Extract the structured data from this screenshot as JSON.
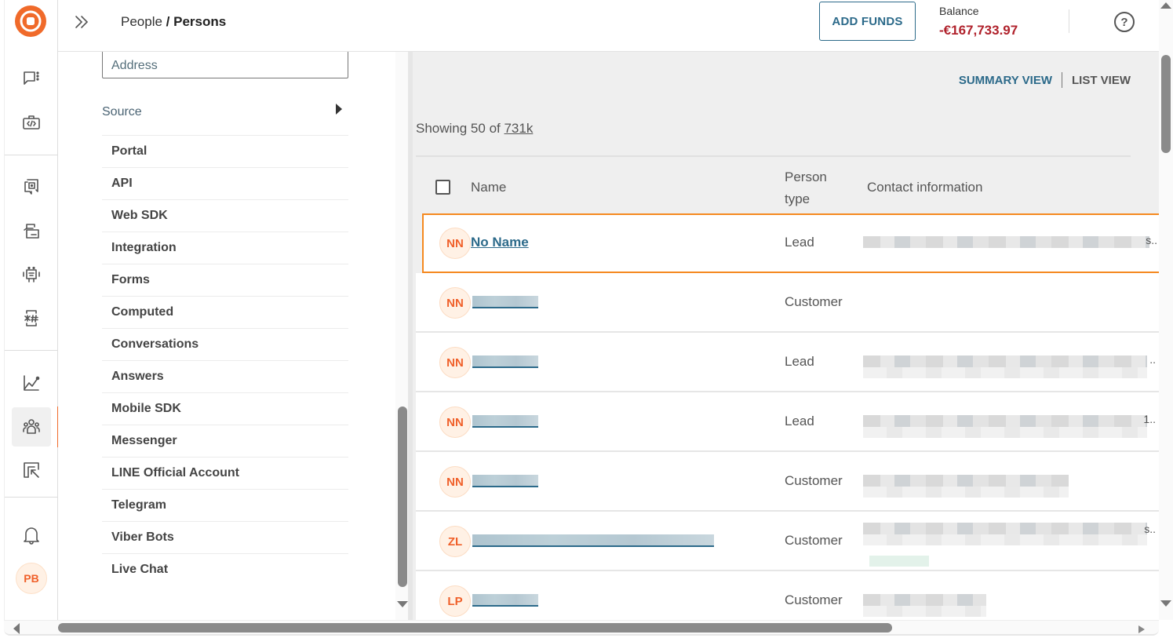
{
  "header": {
    "breadcrumb_parent": "People",
    "breadcrumb_separator": " / ",
    "breadcrumb_current": "Persons",
    "add_funds_label": "ADD FUNDS",
    "balance_label": "Balance",
    "balance_value": "-€167,733.97",
    "help_label": "?"
  },
  "colors": {
    "brand": "#f06a2a",
    "link": "#2c6a8a",
    "negative_balance": "#b0222c",
    "selected_row_outline": "#f5891f"
  },
  "rail": {
    "logo": "brand-logo-icon",
    "items": [
      {
        "icon": "conversations-icon"
      },
      {
        "icon": "developer-tools-icon"
      },
      {
        "icon": "answers-icon"
      },
      {
        "icon": "moments-icon"
      },
      {
        "icon": "chatbots-icon"
      },
      {
        "icon": "numbers-icon"
      },
      {
        "icon": "analyze-icon"
      },
      {
        "icon": "people-icon",
        "active": true
      },
      {
        "icon": "exports-icon"
      },
      {
        "icon": "notifications-icon"
      }
    ],
    "user_initials": "PB"
  },
  "filters": {
    "address_label": "Address",
    "source_label": "Source",
    "source_items": [
      "Portal",
      "API",
      "Web SDK",
      "Integration",
      "Forms",
      "Computed",
      "Conversations",
      "Answers",
      "Mobile SDK",
      "Messenger",
      "LINE Official Account",
      "Telegram",
      "Viber Bots",
      "Live Chat"
    ]
  },
  "main": {
    "view_toggle": {
      "summary": "SUMMARY VIEW",
      "list": "LIST VIEW"
    },
    "showing_prefix": "Showing 50 of ",
    "showing_total": "731k",
    "columns": {
      "name": "Name",
      "person_type": "Person type",
      "contact": "Contact information"
    },
    "rows": [
      {
        "initials": "NN",
        "name": "No Name",
        "type": "Lead",
        "contact_redacted": true,
        "truncated": "s..",
        "selected": true
      },
      {
        "initials": "NN",
        "name": "",
        "type": "Customer",
        "contact_redacted": false
      },
      {
        "initials": "NN",
        "name": "",
        "type": "Lead",
        "contact_redacted": true,
        "truncated": ".."
      },
      {
        "initials": "NN",
        "name": "",
        "type": "Lead",
        "contact_redacted": true,
        "truncated": "1.."
      },
      {
        "initials": "NN",
        "name": "",
        "type": "Customer",
        "contact_redacted": true
      },
      {
        "initials": "ZL",
        "name": "",
        "type": "Customer",
        "contact_redacted": true,
        "truncated": "s.."
      },
      {
        "initials": "LP",
        "name": "",
        "type": "Customer",
        "contact_redacted": true
      }
    ]
  }
}
